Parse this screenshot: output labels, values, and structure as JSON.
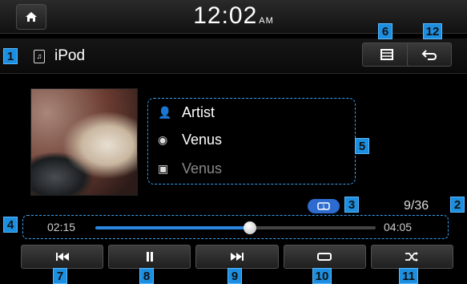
{
  "status": {
    "time": "12:02",
    "ampm": "AM"
  },
  "source": {
    "label": "iPod"
  },
  "track": {
    "artist": "Artist",
    "title": "Venus",
    "album": "Venus"
  },
  "playback": {
    "elapsed": "02:15",
    "total": "04:05",
    "progress_fraction": 0.55,
    "count": "9/36"
  },
  "callouts": [
    "1",
    "2",
    "3",
    "4",
    "5",
    "6",
    "7",
    "8",
    "9",
    "10",
    "11",
    "12"
  ],
  "icons": {
    "home": "home-icon",
    "source": "music-note-icon",
    "list": "list-icon",
    "back": "back-arrow-icon",
    "artist": "person-icon",
    "title": "disc-icon",
    "album": "album-icon",
    "repeat": "repeat-icon",
    "prev": "skip-previous-icon",
    "pause": "pause-icon",
    "next": "skip-next-icon",
    "shuffle": "shuffle-icon"
  },
  "colors": {
    "accent": "#1d8fe0",
    "progress": "#2a86e0"
  }
}
